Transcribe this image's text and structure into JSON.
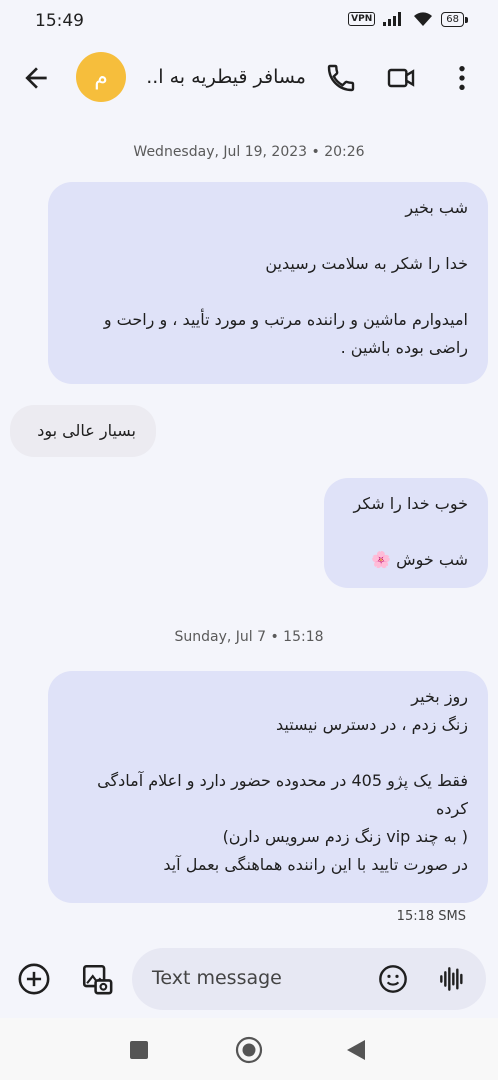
{
  "status": {
    "time": "15:49",
    "vpn": "VPN",
    "battery": "68"
  },
  "header": {
    "avatar_letter": "م",
    "title": "مسافر قیطریه به ا..."
  },
  "messages": [
    {
      "type": "stamp",
      "text": "Wednesday, Jul 19, 2023 • 20:26"
    },
    {
      "type": "out",
      "text": "شب بخیر\n\nخدا را شکر به سلامت رسیدین\n\nامیدوارم ماشین و راننده مرتب و مورد تأیید ، و راحت و راضی بوده باشین ."
    },
    {
      "type": "in",
      "text": "بسیار عالی بود"
    },
    {
      "type": "out",
      "text": "خوب خدا را شکر\n\nشب خوش 🌸"
    },
    {
      "type": "stamp",
      "text": "Sunday, Jul 7 • 15:18"
    },
    {
      "type": "out",
      "text": "روز بخیر\nزنگ زدم ، در دسترس نیستید\n\nفقط یک پژو 405 در محدوده حضور دارد و اعلام آمادگی کرده\n( به چند vip زنگ زدم سرویس دارن)\nدر صورت تایید با این راننده هماهنگی بعمل آید"
    }
  ],
  "last_meta": "15:18 SMS",
  "composer": {
    "placeholder": "Text message"
  },
  "colors": {
    "accent_avatar": "#f6be3c",
    "outgoing_bubble": "#dfe2f8",
    "incoming_bubble": "#ecebf1"
  }
}
